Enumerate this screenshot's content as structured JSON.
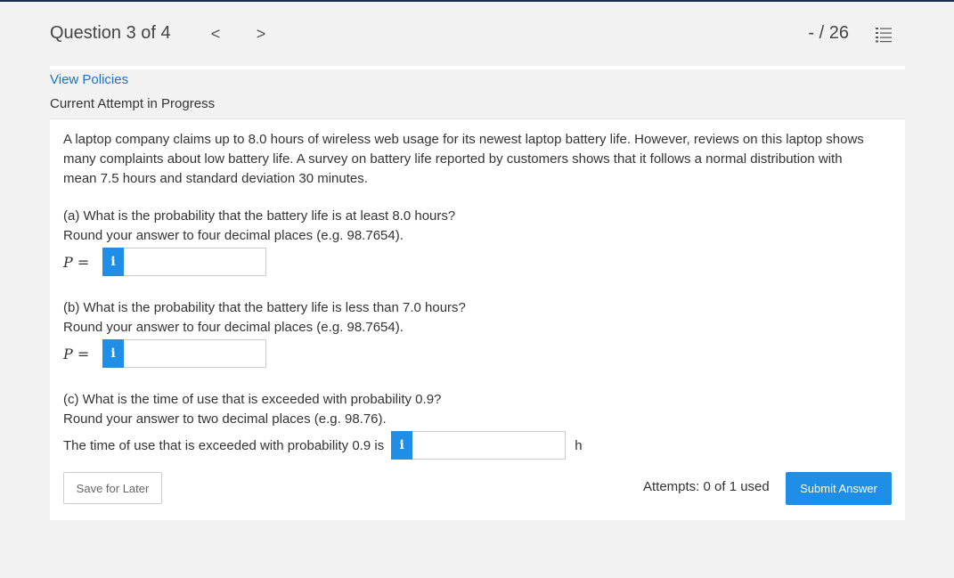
{
  "header": {
    "question_label": "Question 3 of 4",
    "prev_glyph": "<",
    "next_glyph": ">",
    "score": "- / 26"
  },
  "links": {
    "view_policies": "View Policies"
  },
  "section": {
    "heading": "Current Attempt in Progress"
  },
  "problem": {
    "text": "A laptop company claims up to 8.0 hours of wireless web usage for its newest laptop battery life. However, reviews on this laptop shows many complaints about low battery life. A survey on battery life reported by customers shows that it follows a normal distribution with mean 7.5 hours and standard deviation 30 minutes."
  },
  "parts": [
    {
      "question": "(a) What is the probability that the battery life is at least 8.0 hours?",
      "instruction": "Round your answer to four decimal places (e.g. 98.7654).",
      "label_var": "P",
      "label_eq": " =",
      "info": "i",
      "value": ""
    },
    {
      "question": "(b) What is the probability that the battery life is less than 7.0 hours?",
      "instruction": "Round your answer to four decimal places (e.g. 98.7654).",
      "label_var": "P",
      "label_eq": " =",
      "info": "i",
      "value": ""
    },
    {
      "question": "(c) What is the time of use that is exceeded with probability 0.9?",
      "instruction": "Round your answer to two decimal places (e.g. 98.76).",
      "label_text": "The time of use that is exceeded with probability 0.9 is",
      "info": "i",
      "unit": "h",
      "value": ""
    }
  ],
  "footer": {
    "save_label": "Save for Later",
    "attempts": "Attempts: 0 of 1 used",
    "submit_label": "Submit Answer"
  },
  "colors": {
    "accent": "#1f8ee6",
    "link": "#1a73c9",
    "top_border": "#1c2b4a"
  }
}
